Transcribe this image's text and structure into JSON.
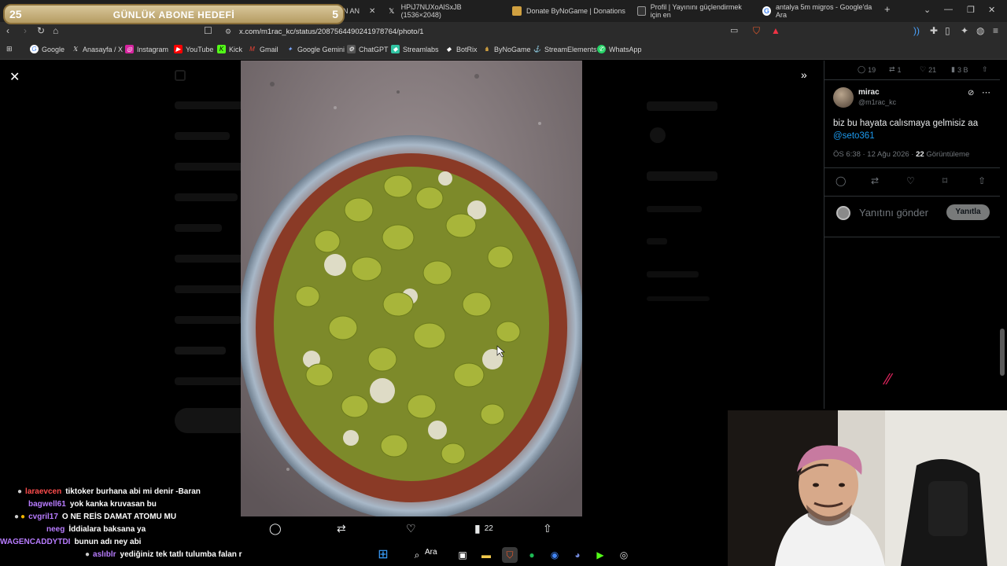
{
  "browser": {
    "tabs": [
      {
        "label": "N AN"
      },
      {
        "label": "HPiJ7NUXoAlSxJB (1536×2048)"
      },
      {
        "label": "Donate ByNoGame | Donations"
      },
      {
        "label": "Profil | Yayınını güçlendirmek için en"
      },
      {
        "label": "antalya 5m migros - Google'da Ara"
      }
    ],
    "new_tab": "+",
    "url": "x.com/m1rac_kc/status/2087564490241978764/photo/1",
    "bookmarks": [
      "Google",
      "Anasayfa / X",
      "Instagram",
      "YouTube",
      "Kick",
      "Gmail",
      "Google Gemini",
      "ChatGPT",
      "Streamlabs",
      "BotRix",
      "ByNoGame",
      "StreamElements",
      "WhatsApp"
    ]
  },
  "goal": {
    "current": "25",
    "title": "GÜNLÜK ABONE HEDEFİ",
    "target": "5"
  },
  "photo_actions": {
    "views": "22"
  },
  "tweet": {
    "stats": {
      "replies": "19",
      "reposts": "1",
      "likes": "21",
      "views": "3 B"
    },
    "author_name": "mirac",
    "author_handle": "@m1rac_kc",
    "text": "biz bu hayata calısmaya gelmisiz aa",
    "mention": "@seto361",
    "time": "ÖS 6:38 · 12 Ağu 2026 · ",
    "view_count": "22",
    "view_label": " Görüntüleme",
    "reply_placeholder": "Yanıtını gönder",
    "reply_button": "Yanıtla"
  },
  "chat": [
    {
      "user": "laraevcen",
      "color": "#ff4d4d",
      "msg": "tiktoker burhana abi mi denir -Baran"
    },
    {
      "user": "bagwell61",
      "color": "#b87cff",
      "msg": "yok kanka kruvasan bu"
    },
    {
      "user": "cvgril17",
      "color": "#b87cff",
      "msg": "O NE REİS DAMAT ATOMU MU"
    },
    {
      "user": "neeg",
      "color": "#b87cff",
      "msg": "İddialara baksana ya"
    },
    {
      "user": "WAGENCADDYTDI",
      "color": "#b87cff",
      "msg": "bunun adı ney abi"
    },
    {
      "user": "aslıblr",
      "color": "#b87cff",
      "msg": "yediğiniz tek tatlı tulumba falan r"
    }
  ],
  "taskbar": {
    "search": "Ara"
  }
}
